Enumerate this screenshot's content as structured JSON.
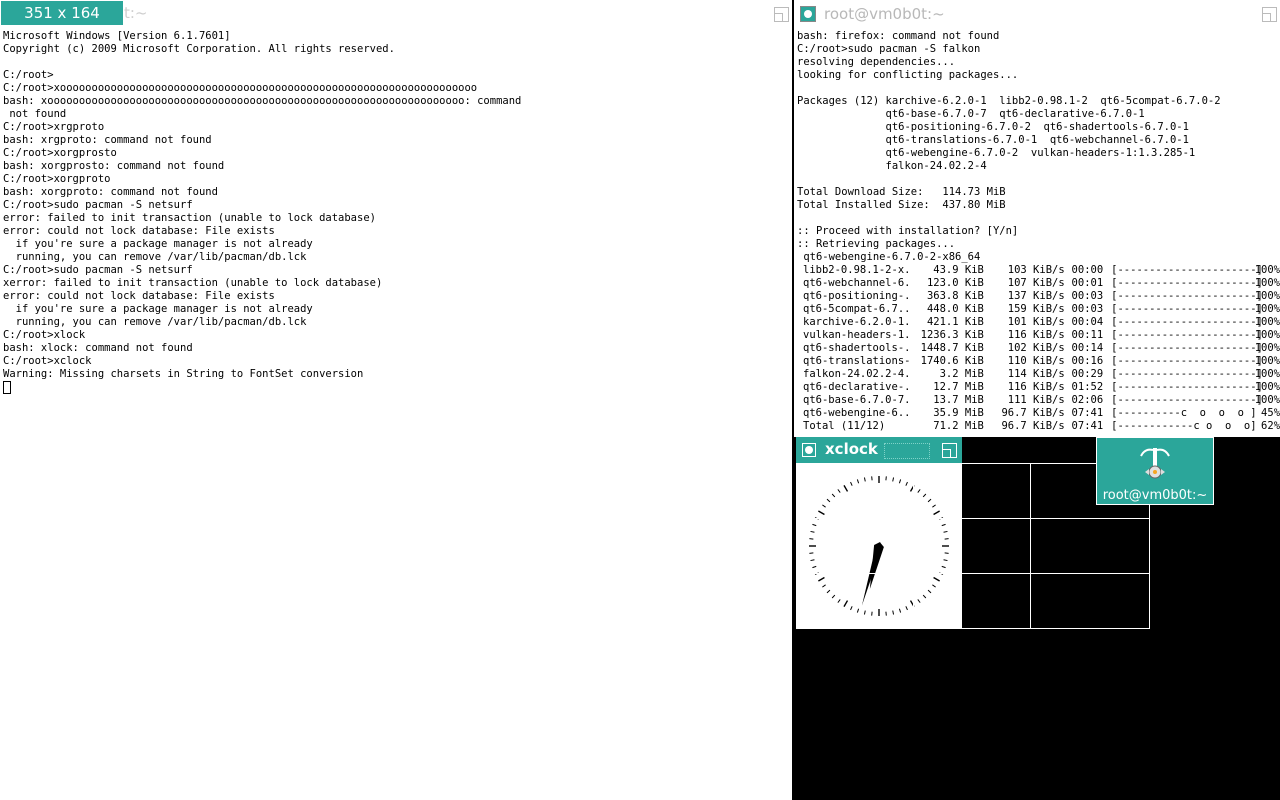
{
  "left_terminal": {
    "size_label": "351 x 164",
    "title_fragment": "t:~",
    "lines": [
      "Microsoft Windows [Version 6.1.7601]",
      "Copyright (c) 2009 Microsoft Corporation. All rights reserved.",
      "",
      "C:/root>",
      "C:/root>xoooooooooooooooooooooooooooooooooooooooooooooooooooooooooooooooooo",
      "bash: xoooooooooooooooooooooooooooooooooooooooooooooooooooooooooooooooooo: command",
      " not found",
      "C:/root>xrgproto",
      "bash: xrgproto: command not found",
      "C:/root>xorgprosto",
      "bash: xorgprosto: command not found",
      "C:/root>xorgproto",
      "bash: xorgproto: command not found",
      "C:/root>sudo pacman -S netsurf",
      "error: failed to init transaction (unable to lock database)",
      "error: could not lock database: File exists",
      "  if you're sure a package manager is not already",
      "  running, you can remove /var/lib/pacman/db.lck",
      "C:/root>sudo pacman -S netsurf",
      "xerror: failed to init transaction (unable to lock database)",
      "error: could not lock database: File exists",
      "  if you're sure a package manager is not already",
      "  running, you can remove /var/lib/pacman/db.lck",
      "C:/root>xlock",
      "bash: xlock: command not found",
      "C:/root>xclock",
      "Warning: Missing charsets in String to FontSet conversion"
    ]
  },
  "right_terminal": {
    "title": "root@vm0b0t:~",
    "lines": [
      "bash: firefox: command not found",
      "C:/root>sudo pacman -S falkon",
      "resolving dependencies...",
      "looking for conflicting packages...",
      "",
      "Packages (12) karchive-6.2.0-1  libb2-0.98.1-2  qt6-5compat-6.7.0-2",
      "              qt6-base-6.7.0-7  qt6-declarative-6.7.0-1",
      "              qt6-positioning-6.7.0-2  qt6-shadertools-6.7.0-1",
      "              qt6-translations-6.7.0-1  qt6-webchannel-6.7.0-1",
      "              qt6-webengine-6.7.0-2  vulkan-headers-1:1.3.285-1",
      "              falkon-24.02.2-4",
      "",
      "Total Download Size:   114.73 MiB",
      "Total Installed Size:  437.80 MiB",
      "",
      ":: Proceed with installation? [Y/n]",
      ":: Retrieving packages...",
      " qt6-webengine-6.7.0-2-x86_64"
    ],
    "downloads": [
      {
        "name": "libb2-0.98.1-2-x...",
        "size": "43.9 KiB",
        "rate": "103 KiB/s",
        "time": "00:00",
        "bar": "[----------------------]",
        "pct": "100%"
      },
      {
        "name": "qt6-webchannel-6...",
        "size": "123.0 KiB",
        "rate": "107 KiB/s",
        "time": "00:01",
        "bar": "[----------------------]",
        "pct": "100%"
      },
      {
        "name": "qt6-positioning-...",
        "size": "363.8 KiB",
        "rate": "137 KiB/s",
        "time": "00:03",
        "bar": "[----------------------]",
        "pct": "100%"
      },
      {
        "name": "qt6-5compat-6.7....",
        "size": "448.0 KiB",
        "rate": "159 KiB/s",
        "time": "00:03",
        "bar": "[----------------------]",
        "pct": "100%"
      },
      {
        "name": "karchive-6.2.0-1...",
        "size": "421.1 KiB",
        "rate": "101 KiB/s",
        "time": "00:04",
        "bar": "[----------------------]",
        "pct": "100%"
      },
      {
        "name": "vulkan-headers-1...",
        "size": "1236.3 KiB",
        "rate": "116 KiB/s",
        "time": "00:11",
        "bar": "[----------------------]",
        "pct": "100%"
      },
      {
        "name": "qt6-shadertools-...",
        "size": "1448.7 KiB",
        "rate": "102 KiB/s",
        "time": "00:14",
        "bar": "[----------------------]",
        "pct": "100%"
      },
      {
        "name": "qt6-translations-...",
        "size": "1740.6 KiB",
        "rate": "110 KiB/s",
        "time": "00:16",
        "bar": "[----------------------]",
        "pct": "100%"
      },
      {
        "name": "falkon-24.02.2-4...",
        "size": "3.2 MiB",
        "rate": "114 KiB/s",
        "time": "00:29",
        "bar": "[----------------------]",
        "pct": "100%"
      },
      {
        "name": "qt6-declarative-...",
        "size": "12.7 MiB",
        "rate": "116 KiB/s",
        "time": "01:52",
        "bar": "[----------------------]",
        "pct": "100%"
      },
      {
        "name": "qt6-base-6.7.0-7...",
        "size": "13.7 MiB",
        "rate": "111 KiB/s",
        "time": "02:06",
        "bar": "[----------------------]",
        "pct": "100%"
      },
      {
        "name": "qt6-webengine-6....",
        "size": "35.9 MiB",
        "rate": "96.7 KiB/s",
        "time": "07:41",
        "bar": "[----------c  o  o  o ]",
        "pct": "45%"
      },
      {
        "name": "Total (11/12)",
        "size": "71.2 MiB",
        "rate": "96.7 KiB/s",
        "time": "07:41",
        "bar": "[------------c o  o  o]",
        "pct": "62%"
      }
    ]
  },
  "xclock": {
    "title": "xclock",
    "hour_angle_deg": 192,
    "minute_angle_deg": 196
  },
  "icon_window": {
    "label": "root@vm0b0t:~"
  },
  "colors": {
    "accent": "#2ba69a",
    "background": "#000000",
    "terminal_bg": "#ffffff"
  }
}
